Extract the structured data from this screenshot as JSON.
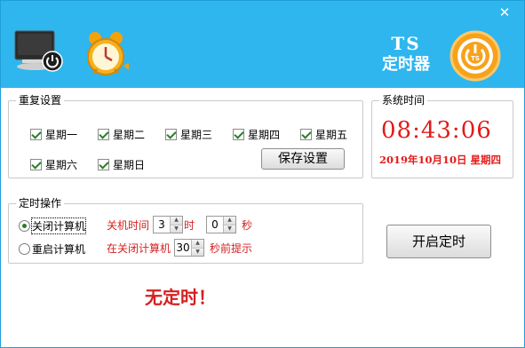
{
  "window": {
    "close_glyph": "✕"
  },
  "brand": {
    "ts": "TS",
    "name": "定时器"
  },
  "repeat": {
    "title": "重复设置",
    "days": [
      "星期一",
      "星期二",
      "星期三",
      "星期四",
      "星期五",
      "星期六",
      "星期日"
    ],
    "save_label": "保存设置"
  },
  "clock": {
    "title": "系统时间",
    "time": "08:43:06",
    "date": "2019年10月10日 星期四"
  },
  "operation": {
    "title": "定时操作",
    "shutdown_label": "关闭计算机",
    "restart_label": "重启计算机",
    "shutdown_time_label": "关机时间",
    "hour_value": "3",
    "hour_unit": "时",
    "minute_value": "0",
    "minute_unit": "秒",
    "warn_prefix": "在关闭计算机",
    "warn_value": "30",
    "warn_suffix": "秒前提示"
  },
  "start_label": "开启定时",
  "status_text": "无定时！",
  "colors": {
    "header": "#2fb6ee",
    "accent_red": "#d42020",
    "logo_orange": "#f7a21b"
  },
  "icons": [
    "monitor-power-icon",
    "alarm-clock-icon",
    "power-logo-icon",
    "checkmark-icon",
    "spinner-arrows-icon"
  ]
}
